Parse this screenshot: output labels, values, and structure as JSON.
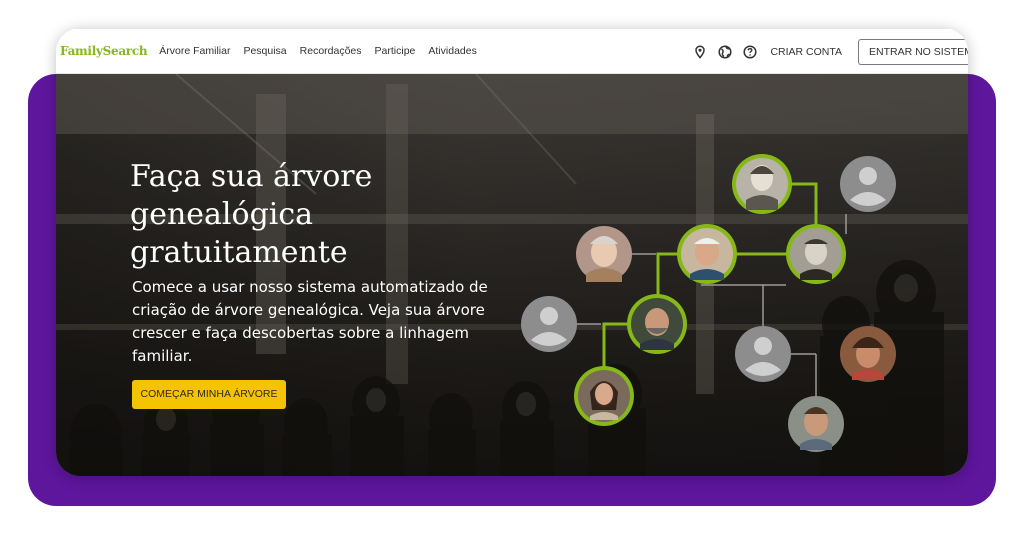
{
  "header": {
    "logo": "FamilySearch",
    "nav": [
      "Árvore Familiar",
      "Pesquisa",
      "Recordações",
      "Participe",
      "Atividades"
    ],
    "icons": [
      "location-icon",
      "globe-icon",
      "help-icon"
    ],
    "create_account": "CRIAR CONTA",
    "sign_in": "ENTRAR NO SISTEMA"
  },
  "hero": {
    "title": "Faça sua árvore genealógica gratuitamente",
    "subtitle": "Comece a usar nosso sistema automatizado de criação de árvore genealógica. Veja sua árvore crescer e faça descobertas sobre a linhagem familiar.",
    "cta": "COMEÇAR MINHA ÁRVORE"
  },
  "colors": {
    "brand_green": "#86b817",
    "accent_yellow": "#f5c400",
    "frame_purple": "#5e169d",
    "tree_line": "#86b817"
  }
}
